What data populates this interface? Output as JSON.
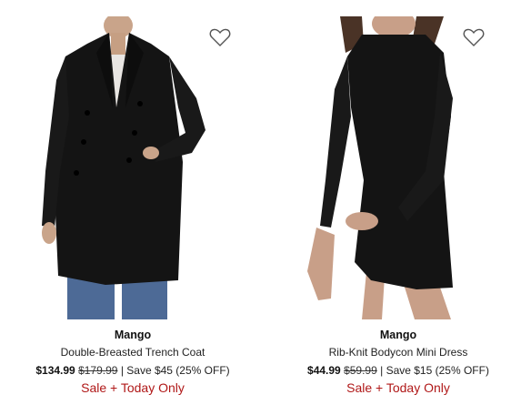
{
  "products": [
    {
      "brand": "Mango",
      "title": "Double-Breasted Trench Coat",
      "price_now": "$134.99",
      "price_was": "$179.99",
      "savings": "| Save $45 (25% OFF)",
      "promo": "Sale + Today Only",
      "icon": "heart-outline-icon"
    },
    {
      "brand": "Mango",
      "title": "Rib-Knit Bodycon Mini Dress",
      "price_now": "$44.99",
      "price_was": "$59.99",
      "savings": "| Save $15 (25% OFF)",
      "promo": "Sale + Today Only",
      "icon": "heart-outline-icon"
    }
  ],
  "colors": {
    "promo": "#b01818",
    "text": "#111111",
    "garment": "#141414"
  }
}
